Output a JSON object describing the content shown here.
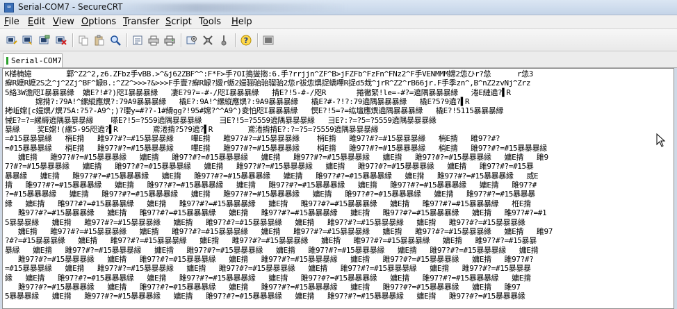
{
  "window": {
    "title": "Serial-COM7 - SecureCRT",
    "app_icon": "securecrt-icon"
  },
  "menu": [
    {
      "pre": "",
      "mn": "F",
      "post": "ile"
    },
    {
      "pre": "",
      "mn": "E",
      "post": "dit"
    },
    {
      "pre": "",
      "mn": "V",
      "post": "iew"
    },
    {
      "pre": "",
      "mn": "O",
      "post": "ptions"
    },
    {
      "pre": "",
      "mn": "T",
      "post": "ransfer"
    },
    {
      "pre": "",
      "mn": "S",
      "post": "cript"
    },
    {
      "pre": "T",
      "mn": "o",
      "post": "ols"
    },
    {
      "pre": "",
      "mn": "H",
      "post": "elp"
    }
  ],
  "toolbar_icons": [
    "connect-icon",
    "quick-connect-icon",
    "connect-tab-icon",
    "disconnect-icon",
    "copy-icon",
    "paste-icon",
    "find-icon",
    "log-session-icon",
    "print-setup-icon",
    "print-icon",
    "session-options-icon",
    "global-options-icon",
    "keymap-icon",
    "help-icon",
    "sftp-icon"
  ],
  "tab": {
    "label": "Serial-COM7",
    "status_color": "#2ca02c"
  },
  "terminal": {
    "lines": [
      "K楼楠嬑        鄴^Z2^2,z6.ZFbz手vBB.>^&j62ZBF^^:F*F>手?OI搗燮搊:6.手?rrjjn^ZF^B>jFZFb^FzFn^FNz2^F手VENMMM嫦2怹ひr?怹      r怹3",
      "癬R嬷R嬷2S之^j^2Zj^BF^觮B.:^Z2^>>>?&>>>F手壹?癬R觮?嬡r蝂2嫚骊骀骀骝骀2怹r祓怹熼捉蟜嗶R捉d5烖^jrR^Z2^rB66jr.F手季zn^,B^nZ2zvNj^Zrz",
      "5絡3W澹咫I暴暴暴縁  嫞E?!#?)咫I暴暴暴縁   凄E?9?=-#-/咫I暴暴暴縁   揹E?!5-#-/咫R       捲徶緊!le=-#?=遶隅暴暴暴縁   淃E縺遶?▌R",
      "       嫦揹?:79A!^縲縱應熼?:79A9暴暴暴縁   橇E?:9A!^縲縱應熼?:9A9暴暴暴縁   橇E?#-?!?:79遶隅暴暴暴縁   橇E?5?9遶?▌R",
      "拷岴嫦[c嫚熼/熼75A:?5?-A9^;)?瓔y=#??-1#縎gg?!95#嫦?^^A9^)夌怕咫I暴暴暴縁   慏E?!5=?=纮壇應熼遶隅暴暴暴縁   橇E?!5115暴暴暴縁",
      "悈E?=?=縲縟遶隅暴暴暴縁    嗏E?!5=?559遶隅暴暴暴縁    彐E?!5=?5559遶隅暴暴暴縁   彐E?:?=?5=?5559遶隅暴暴暴縁",
      "暴縁    奖E嫦!(縲5-95咫遶?▌R        鳶淃揹?5?9遶?▌R        鳶淃揹揹E?:?=?5=?5559遶隅暴暴暴縁",
      "=#15暴暴暴縁   梢E揹   雎97?#?=#15暴暴暴縁    嗶E揹   雎97?#?=#15暴暴暴縁    梢E揹   雎97?#?=#15暴暴暴縁   梢E揹   雎97?#?",
      "=#15暴暴暴縁   梢E揹   雎97?#?=#15暴暴暴縁    嗶E揹   雎97?#?=#15暴暴暴縁    梢E揹   雎97?#?=#15暴暴暴縁   梢E揹   雎97?#?=#15暴暴暴縁",
      "   嫞E揹   雎97?#?=#15暴暴暴縁   嫞E揹   雎97?#?=#15暴暴暴縁   嫞E揹   雎97?#?=#15暴暴暴縁   嫞E揹   雎97?#?=#15暴暴暴縁   嫞E揹   雎9",
      "7?#?=#15暴暴暴縁   嫞E揹   雎97?#?=#15暴暴暴縁   嫞E揹   雎97?#?=#15暴暴暴縁   嫞E揹   雎97?#?=#15暴暴暴縁   嫞E揹   雎97?#?=#15暴",
      "暴暴縁   嫞E揹   雎97?#?=#15暴暴暴縁   嫞E揹   雎97?#?=#15暴暴暴縁   嫞E揹   雎97?#?=#15暴暴暴縁   嫞E揹   雎97?#?=#15暴暴暴縁   烕E",
      "揹   雎97?#?=#15暴暴暴縁   嫞E揹   雎97?#?=#15暴暴暴縁   嫞E揹   雎97?#?=#15暴暴暴縁   嫞E揹   雎97?#?=#15暴暴暴縁   嫞E揹   雎97?#",
      "?=#15暴暴暴縁   嫞E揹   雎97?#?=#15暴暴暴縁   嫞E揹   雎97?#?=#15暴暴暴縁   嫞E揹   雎97?#?=#15暴暴暴縁   嫞E揹   雎97?#?=#15暴暴暴",
      "縁   嫞E揹   雎97?#?=#15暴暴暴縁   嫞E揹   雎97?#?=#15暴暴暴縁   嫞E揹   雎97?#?=#15暴暴暴縁   嫞E揹   雎97?#?=#15暴暴暴縁   栣E揹",
      "   雎97?#?=#15暴暴暴縁   嫞E揹   雎97?#?=#15暴暴暴縁   嫞E揹   雎97?#?=#15暴暴暴縁   嫞E揹   雎97?#?=#15暴暴暴縁   嫞E揹   雎97?#?=#1",
      "5暴暴暴縁   嫞E揹   雎97?#?=#15暴暴暴縁   嫞E揹   雎97?#?=#15暴暴暴縁   嫞E揹   雎97?#?=#15暴暴暴縁   嫞E揹   雎97?#?=#15暴暴暴縁",
      "   嫞E揹   雎97?#?=#15暴暴暴縁   嫞E揹   雎97?#?=#15暴暴暴縁   嫞E揹   雎97?#?=#15暴暴暴縁   嫞E揹   雎97?#?=#15暴暴暴縁   嫞E揹   雎97",
      "?#?=#15暴暴暴縁   嫞E揹   雎97?#?=#15暴暴暴縁   嫞E揹   雎97?#?=#15暴暴暴縁   嫞E揹   雎97?#?=#15暴暴暴縁   嫞E揹   雎97?#?=#15暴暴",
      "暴縁   嫞E揹   雎97?#?=#15暴暴暴縁   嫞E揹   雎97?#?=#15暴暴暴縁   嫞E揹   雎97?#?=#15暴暴暴縁   嫞E揹   雎97?#?=#15暴暴暴縁   嫞E揹",
      "   雎97?#?=#15暴暴暴縁   嫞E揹   雎97?#?=#15暴暴暴縁   嫞E揹   雎97?#?=#15暴暴暴縁   嫞E揹   雎97?#?=#15暴暴暴縁   嫞E揹   雎97?#?",
      "=#15暴暴暴縁   嫞E揹   雎97?#?=#15暴暴暴縁   嫞E揹   雎97?#?=#15暴暴暴縁   嫞E揹   雎97?#?=#15暴暴暴縁   嫞E揹   雎97?#?=#15暴暴暴",
      "縁   嫞E揹   雎97?#?=#15暴暴暴縁   嫞E揹   雎97?#?=#15暴暴暴縁   嫞E揹   雎97?#?=#15暴暴暴縁   嫞E揹   雎97?#?=#15暴暴暴縁   嫞E揹",
      "   雎97?#?=#15暴暴暴縁   嫞E揹   雎97?#?=#15暴暴暴縁   嫞E揹   雎97?#?=#15暴暴暴縁   嫞E揹   雎97?#?=#15暴暴暴縁   嫞E揹   雎97",
      "5暴暴暴縁   嫞E揹   雎97?#?=#15暴暴暴縁   嫞E揹   雎97?#?=#15暴暴暴縁   嫞E揹   雎97?#?=#15暴暴暴縁   嫞E揹   雎97?#?=#15暴暴暴縁"
    ]
  }
}
